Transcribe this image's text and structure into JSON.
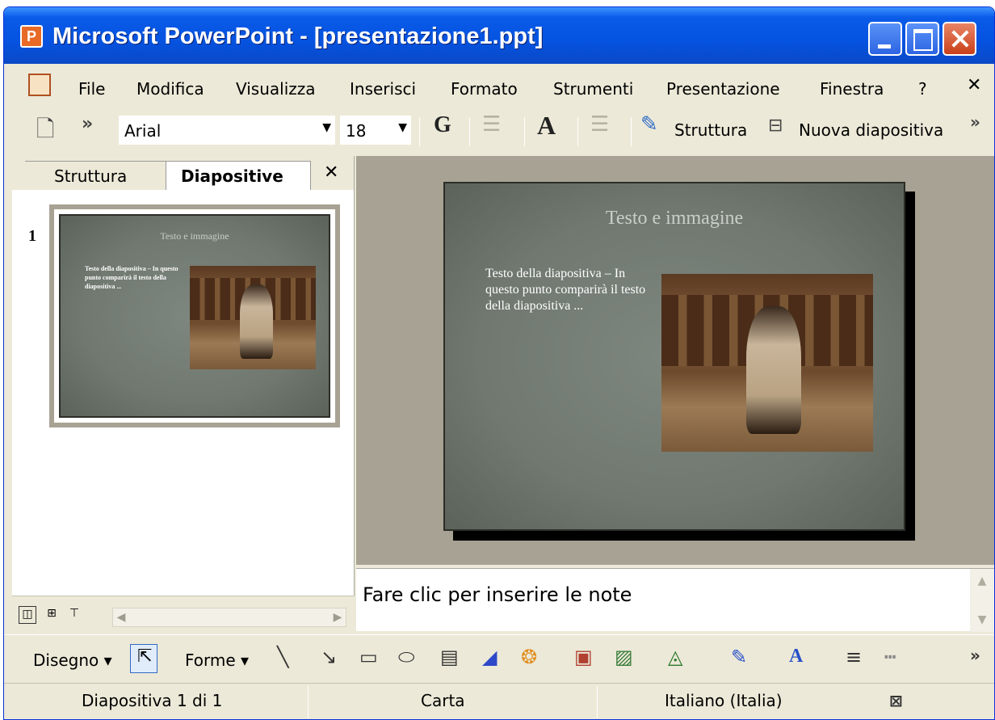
{
  "window": {
    "title": "Microsoft PowerPoint - [presentazione1.ppt]",
    "app_icon": "powerpoint-icon"
  },
  "menu": {
    "items": [
      "File",
      "Modifica",
      "Visualizza",
      "Inserisci",
      "Formato",
      "Strumenti",
      "Presentazione",
      "Finestra",
      "?"
    ],
    "close_glyph": "✕"
  },
  "toolbar": {
    "overflow_glyph": "»",
    "font_name": "Arial",
    "font_size": "18",
    "bold_label": "G",
    "outline_label": "Struttura",
    "new_slide_label": "Nuova diapositiva"
  },
  "left_pane": {
    "tabs": [
      "Struttura",
      "Diapositive"
    ],
    "active_tab": "Diapositive",
    "close_glyph": "✕",
    "slide_number": "1"
  },
  "slide": {
    "title": "Testo e immagine",
    "body": "Testo della diapositiva – In questo punto comparirà il testo della diapositiva ..."
  },
  "notes": {
    "placeholder": "Fare clic per inserire le note"
  },
  "drawing_toolbar": {
    "draw_label": "Disegno",
    "shapes_label": "Forme"
  },
  "status_bar": {
    "slide_position": "Diapositiva 1 di 1",
    "design": "Carta",
    "language": "Italiano (Italia)"
  },
  "colors": {
    "titlebar": "#0553E0",
    "chrome": "#ECE9D8",
    "slide_background": "#747C74",
    "close_button": "#C9401A"
  }
}
